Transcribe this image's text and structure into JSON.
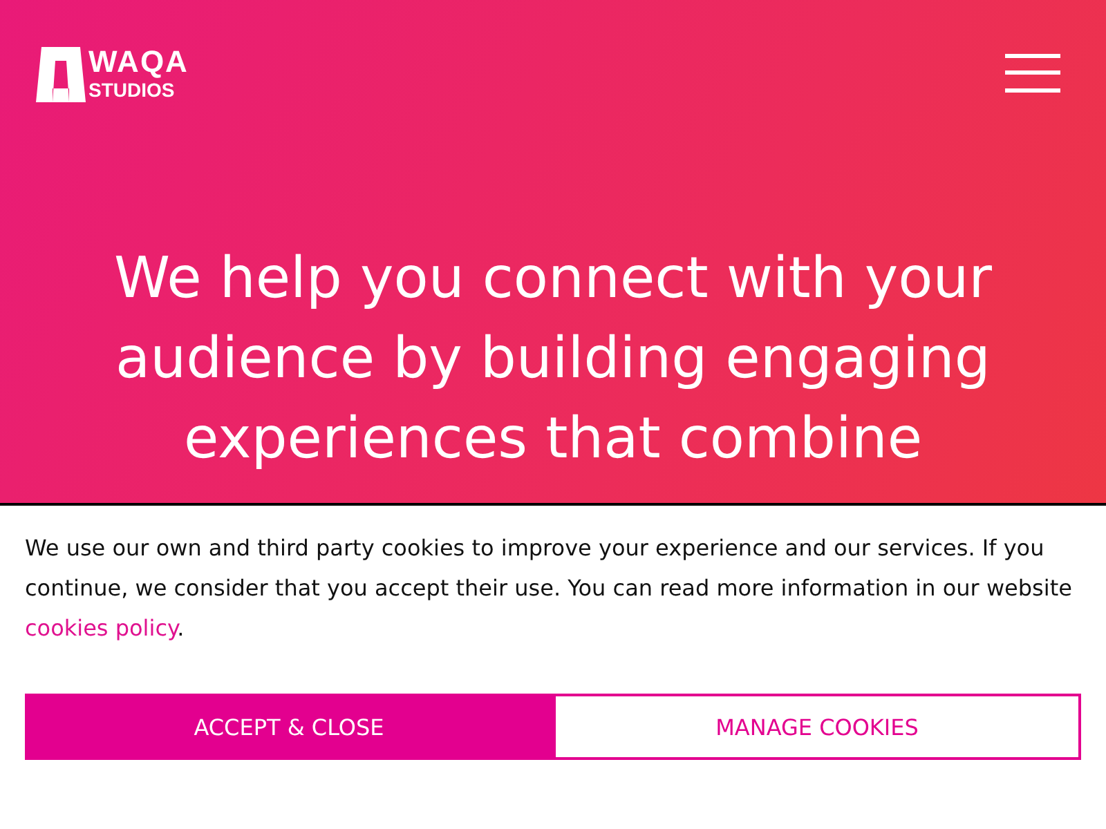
{
  "header": {
    "logo": {
      "wordmark": "WAQA",
      "subtitle": "STUDIOS"
    }
  },
  "hero": {
    "heading": "We help you connect with your audience by building engaging experiences that combine"
  },
  "cookie_banner": {
    "text": "We use our own and third party cookies to improve your experience and our services. If you continue, we consider that you accept their use. You can read more information in our website ",
    "link": "cookies policy",
    "text_end": ".",
    "buttons": [
      {
        "label": "ACCEPT & CLOSE",
        "kind": "primary"
      },
      {
        "label": "MANAGE COOKIES",
        "kind": "outline"
      }
    ]
  }
}
